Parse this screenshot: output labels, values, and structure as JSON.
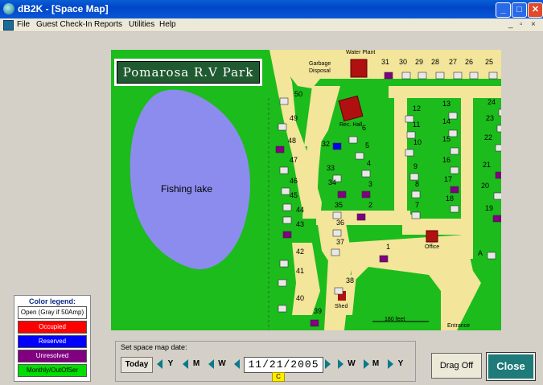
{
  "window": {
    "title": "dB2K - [Space Map]"
  },
  "menu": {
    "items": [
      "File",
      "Guest Check-In",
      "Reports",
      "Utilities",
      "Help"
    ]
  },
  "map": {
    "title": "Pomarosa R.V Park",
    "lake_label": "Fishing lake",
    "labels": {
      "water_plant": "Water Plant",
      "garbage": "Garbage",
      "disposal": "Disposal",
      "rec_hall": "Rec. Hall",
      "office": "Office",
      "shed": "Shed",
      "scale": "180 feet",
      "entrance": "Entrance"
    },
    "sites": [
      "50",
      "49",
      "48",
      "47",
      "46",
      "45",
      "44",
      "43",
      "42",
      "41",
      "40",
      "39",
      "38",
      "37",
      "36",
      "35",
      "34",
      "33",
      "32",
      "6",
      "5",
      "4",
      "3",
      "2",
      "1",
      "12",
      "11",
      "10",
      "9",
      "8",
      "7",
      "13",
      "14",
      "15",
      "16",
      "17",
      "18",
      "19",
      "20",
      "21",
      "22",
      "23",
      "24",
      "25",
      "26",
      "27",
      "28",
      "29",
      "30",
      "31",
      "A"
    ]
  },
  "legend": {
    "title": "Color legend:",
    "items": [
      {
        "label": "Open (Gray if 50Amp)",
        "color": "#ffffff",
        "text": "#000000"
      },
      {
        "label": "Occupied",
        "color": "#ff0000",
        "text": "#ffffff"
      },
      {
        "label": "Reserved",
        "color": "#0000ff",
        "text": "#ffffff"
      },
      {
        "label": "Unresolved",
        "color": "#800080",
        "text": "#ffffff"
      },
      {
        "label": "Monthly/OutOfSer",
        "color": "#00dd00",
        "text": "#000000"
      }
    ]
  },
  "date_panel": {
    "label": "Set space map date:",
    "today": "Today",
    "y": "Y",
    "m": "M",
    "w": "W",
    "date": "11/21/2005",
    "badge": "C"
  },
  "buttons": {
    "drag_off": "Drag Off",
    "close": "Close"
  }
}
